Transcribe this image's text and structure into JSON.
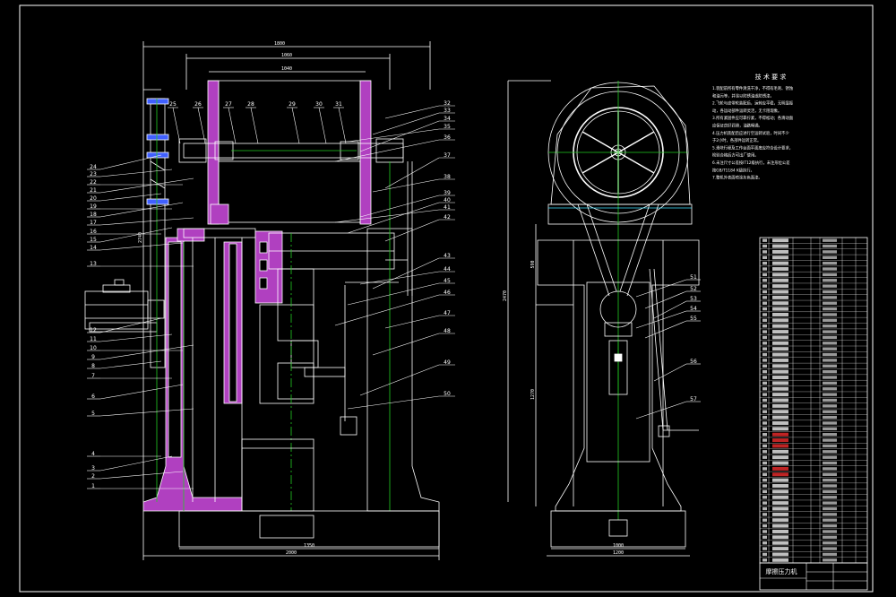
{
  "colors": {
    "background": "#000000",
    "line": "#ffffff",
    "center": "#22cc22",
    "cut": "#b040c0",
    "cyan": "#40e0ff",
    "red": "#ff3030",
    "blue": "#4060ff"
  },
  "left_view": {
    "dimensions": {
      "top": "1800",
      "frame_width": "1060",
      "inner_width": "1040",
      "height": "2740",
      "base_inner": "1350",
      "base_outer": "2000"
    },
    "callouts_top": [
      "25",
      "26",
      "27",
      "28",
      "29",
      "30",
      "31"
    ],
    "callouts_left": [
      "24",
      "23",
      "22",
      "21",
      "20",
      "19",
      "18",
      "17",
      "16",
      "15",
      "14",
      "13",
      "12",
      "11",
      "10",
      "9",
      "8",
      "7",
      "6",
      "5",
      "4",
      "3",
      "2",
      "1"
    ],
    "callouts_right": [
      "32",
      "33",
      "34",
      "35",
      "36",
      "37",
      "38",
      "39",
      "40",
      "41",
      "42",
      "43",
      "44",
      "45",
      "46",
      "47",
      "48",
      "49",
      "50"
    ]
  },
  "right_view": {
    "dimensions": {
      "height": "2470",
      "lower_height": "1270",
      "mid": "590",
      "base_inner": "1000",
      "base_outer": "1200"
    },
    "callouts": [
      "51",
      "52",
      "53",
      "54",
      "55",
      "56",
      "57"
    ]
  },
  "tech_requirements": {
    "title": "技 术 要 求",
    "lines": [
      "1.装配前所有零件清洗干净，不得有毛刺、锈蚀",
      "和油污等，并涂以防锈油或防锈漆。",
      "2.飞轮与皮带轮装配后，运转应平稳，无明显振",
      "动，各运动部件运转灵活，无卡阻现象。",
      "3.所有紧固件应可靠拧紧，不得松动；各滑动面",
      "应保证良好润滑，油路畅通。",
      "4.压力机装配后应进行空运转试验，时间不少",
      "于2小时，各部件运转正常。",
      "5.滑块行程及工作台面平面度应符合设计要求，",
      "检验合格后方可出厂使用。",
      "6.未注尺寸公差按IT12级执行，未注形位公差",
      "按GB/T1184 K级执行。",
      "7.整机外表面喷涂灰色面漆。"
    ]
  },
  "title_block": {
    "title": "摩擦压力机",
    "row_count": 57
  }
}
